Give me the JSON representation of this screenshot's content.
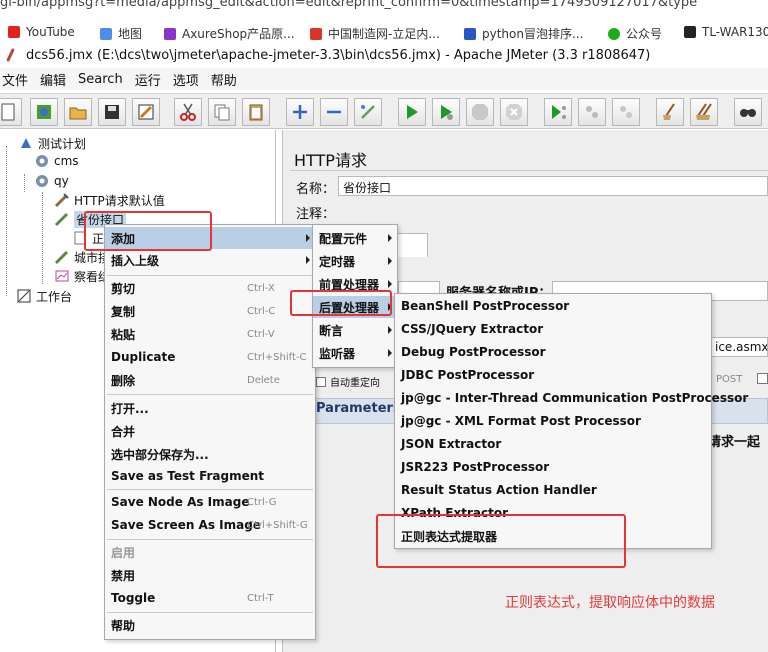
{
  "browser": {
    "url_fragment": "gi-bin/appmsg?t=media/appmsg_edit&action=edit&reprint_confirm=0&timestamp=1749509127017&type",
    "bookmarks": [
      {
        "label": "YouTube",
        "color": "#e62117"
      },
      {
        "label": "地图",
        "color": "#4d8ee8"
      },
      {
        "label": "AxureShop产品原...",
        "color": "#8a35c9"
      },
      {
        "label": "中国制造网-立足内...",
        "color": "#d9362b"
      },
      {
        "label": "python冒泡排序...",
        "color": "#2b57c4"
      },
      {
        "label": "公众号",
        "color": "#1aad19"
      },
      {
        "label": "TL-WAR1300",
        "color": "#222222"
      }
    ]
  },
  "window": {
    "title": "dcs56.jmx (E:\\dcs\\two\\jmeter\\apache-jmeter-3.3\\bin\\dcs56.jmx) - Apache JMeter (3.3 r1808647)"
  },
  "menubar": [
    "文件",
    "编辑",
    "Search",
    "运行",
    "选项",
    "帮助"
  ],
  "toolbar": [
    {
      "name": "new-icon"
    },
    {
      "name": "templates-icon"
    },
    {
      "name": "open-icon"
    },
    {
      "name": "save-icon"
    },
    {
      "name": "save-edit-icon"
    },
    {
      "name": "cut-icon"
    },
    {
      "name": "copy-icon"
    },
    {
      "name": "paste-icon"
    },
    {
      "name": "expand-icon"
    },
    {
      "name": "collapse-icon"
    },
    {
      "name": "toggle-icon"
    },
    {
      "name": "start-icon"
    },
    {
      "name": "start-no-pause-icon"
    },
    {
      "name": "stop-icon"
    },
    {
      "name": "shutdown-icon"
    },
    {
      "name": "remote-start-icon"
    },
    {
      "name": "remote-stop-icon"
    },
    {
      "name": "remote-shutdown-icon"
    },
    {
      "name": "clear-icon"
    },
    {
      "name": "clear-all-icon"
    },
    {
      "name": "search-icon"
    }
  ],
  "tree": {
    "nodes": [
      {
        "label": "测试计划"
      },
      {
        "label": "cms"
      },
      {
        "label": "qy"
      },
      {
        "label": "HTTP请求默认值"
      },
      {
        "label": "省份接口"
      },
      {
        "label": "正"
      },
      {
        "label": "城市接"
      },
      {
        "label": "察看结"
      },
      {
        "label": "工作台"
      }
    ]
  },
  "panel": {
    "title": "HTTP请求",
    "name_label": "名称：",
    "name_value": "省份接口",
    "comment_label": "注释：",
    "tab_label": "ced",
    "server_label": "服务器名称或IP：",
    "path_fragment": "ice.asmx/g",
    "auto_redirect": "自动重定向",
    "post_label": "POST",
    "parameters_label": "Parameters",
    "send_with_request": "请求一起"
  },
  "context_menu": {
    "items": [
      {
        "label": "添加",
        "shortcut": "",
        "submenu": true
      },
      {
        "label": "插入上级",
        "shortcut": "",
        "submenu": true
      },
      {
        "label": "剪切",
        "shortcut": "Ctrl-X"
      },
      {
        "label": "复制",
        "shortcut": "Ctrl-C"
      },
      {
        "label": "粘贴",
        "shortcut": "Ctrl-V"
      },
      {
        "label": "Duplicate",
        "shortcut": "Ctrl+Shift-C"
      },
      {
        "label": "删除",
        "shortcut": "Delete"
      },
      {
        "label": "打开...",
        "shortcut": ""
      },
      {
        "label": "合并",
        "shortcut": ""
      },
      {
        "label": "选中部分保存为...",
        "shortcut": ""
      },
      {
        "label": "Save as Test Fragment",
        "shortcut": ""
      },
      {
        "label": "Save Node As Image",
        "shortcut": "Ctrl-G"
      },
      {
        "label": "Save Screen As Image",
        "shortcut": "Ctrl+Shift-G"
      },
      {
        "label": "启用",
        "shortcut": "",
        "disabled": true
      },
      {
        "label": "禁用",
        "shortcut": ""
      },
      {
        "label": "Toggle",
        "shortcut": "Ctrl-T"
      },
      {
        "label": "帮助",
        "shortcut": ""
      }
    ]
  },
  "add_submenu": {
    "items": [
      {
        "label": "配置元件"
      },
      {
        "label": "定时器"
      },
      {
        "label": "前置处理器"
      },
      {
        "label": "后置处理器"
      },
      {
        "label": "断言"
      },
      {
        "label": "监听器"
      }
    ]
  },
  "post_processor_submenu": {
    "items": [
      {
        "label": "BeanShell PostProcessor"
      },
      {
        "label": "CSS/JQuery Extractor"
      },
      {
        "label": "Debug PostProcessor"
      },
      {
        "label": "JDBC PostProcessor"
      },
      {
        "label": "jp@gc - Inter-Thread Communication PostProcessor"
      },
      {
        "label": "jp@gc - XML Format Post Processor"
      },
      {
        "label": "JSON Extractor"
      },
      {
        "label": "JSR223 PostProcessor"
      },
      {
        "label": "Result Status Action Handler"
      },
      {
        "label": "XPath Extractor"
      },
      {
        "label": "正则表达式提取器"
      }
    ]
  },
  "annotation": "正则表达式，提取响应体中的数据",
  "colors": {
    "highlight": "#b8cfe5",
    "annotation_red": "#e43434"
  }
}
